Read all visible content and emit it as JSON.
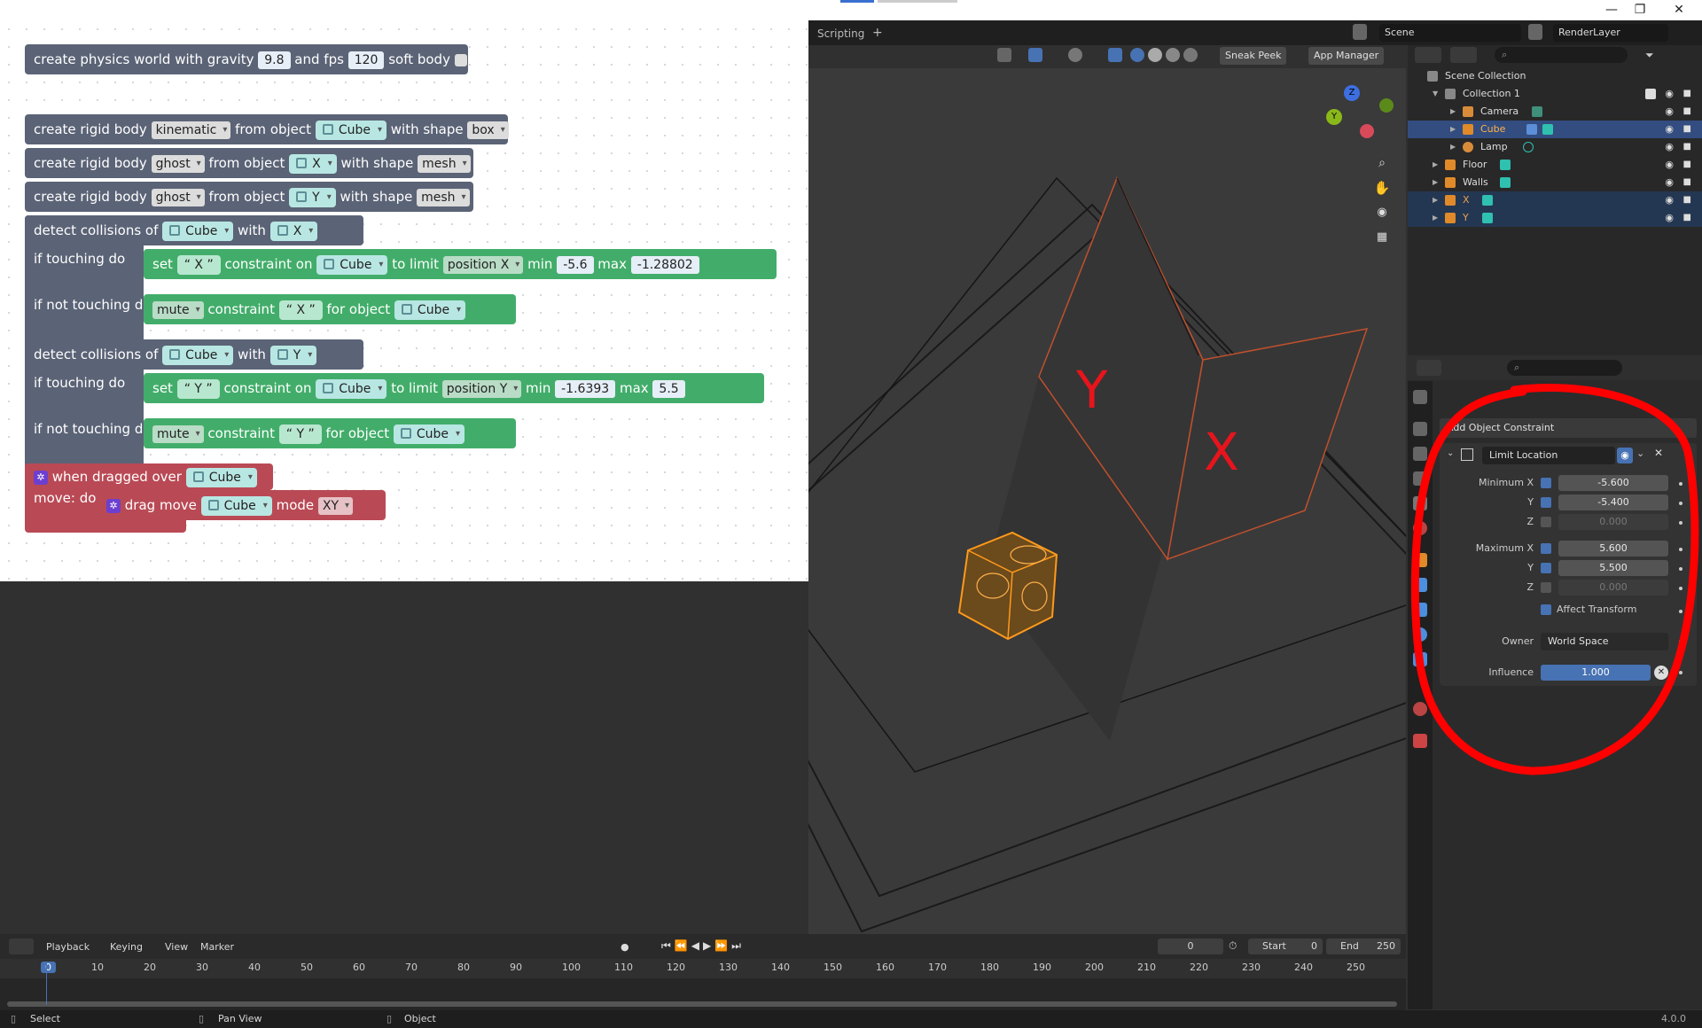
{
  "window": {
    "minimize": "—",
    "restore": "❐",
    "close": "✕"
  },
  "header": {
    "workspace_tab": "Scripting",
    "add_tab": "+",
    "scene_label": "Scene",
    "view_layer_label": "RenderLayer"
  },
  "viewport": {
    "sneak_peek": "Sneak Peek",
    "app_manager": "App Manager",
    "label_y": "Y",
    "label_x": "X"
  },
  "blocks": {
    "physics": {
      "create": "create physics world",
      "with_gravity": "with gravity",
      "gravity": "9.8",
      "and_fps": "and fps",
      "fps": "120",
      "soft_body": "soft body"
    },
    "rb1": {
      "create": "create rigid body",
      "type": "kinematic",
      "from_object": "from object",
      "object": "Cube",
      "with_shape": "with shape",
      "shape": "box"
    },
    "rb2": {
      "create": "create rigid body",
      "type": "ghost",
      "from_object": "from object",
      "object": "X",
      "with_shape": "with shape",
      "shape": "mesh"
    },
    "rb3": {
      "create": "create rigid body",
      "type": "ghost",
      "from_object": "from object",
      "object": "Y",
      "with_shape": "with shape",
      "shape": "mesh"
    },
    "det1": {
      "detect": "detect collisions of",
      "a": "Cube",
      "with": "with",
      "b": "X",
      "touching": "if touching do",
      "not_touching": "if not touching do"
    },
    "set1": {
      "set": "set",
      "name": "X",
      "constraint_on": "constraint on",
      "object": "Cube",
      "to_limit": "to limit",
      "limit": "position X",
      "min": "min",
      "min_val": "-5.6",
      "max": "max",
      "max_val": "-1.28802"
    },
    "mute1": {
      "mute": "mute",
      "constraint": "constraint",
      "name": "X",
      "for_object": "for object",
      "object": "Cube"
    },
    "det2": {
      "detect": "detect collisions of",
      "a": "Cube",
      "with": "with",
      "b": "Y",
      "touching": "if touching do",
      "not_touching": "if not touching do"
    },
    "set2": {
      "set": "set",
      "name": "Y",
      "constraint_on": "constraint on",
      "object": "Cube",
      "to_limit": "to limit",
      "limit": "position Y",
      "min": "min",
      "min_val": "-1.6393",
      "max": "max",
      "max_val": "5.5"
    },
    "mute2": {
      "mute": "mute",
      "constraint": "constraint",
      "name": "Y",
      "for_object": "for object",
      "object": "Cube"
    },
    "drag": {
      "when": "when dragged over",
      "object": "Cube",
      "move": "move: do",
      "drag_move": "drag move",
      "drag_obj": "Cube",
      "mode": "mode",
      "mode_val": "XY"
    }
  },
  "outliner": {
    "scene_collection": "Scene Collection",
    "rows": [
      {
        "label": "Collection 1"
      },
      {
        "label": "Camera"
      },
      {
        "label": "Cube"
      },
      {
        "label": "Lamp"
      },
      {
        "label": "Floor"
      },
      {
        "label": "Walls"
      },
      {
        "label": "X"
      },
      {
        "label": "Y"
      }
    ]
  },
  "properties": {
    "add_constraint": "Add Object Constraint",
    "constraint_name": "Limit Location",
    "min_x_label": "Minimum X",
    "min_x": "-5.600",
    "min_y_label": "Y",
    "min_y": "-5.400",
    "min_z_label": "Z",
    "min_z": "0.000",
    "max_x_label": "Maximum X",
    "max_x": "5.600",
    "max_y_label": "Y",
    "max_y": "5.500",
    "max_z_label": "Z",
    "max_z": "0.000",
    "affect_transform": "Affect Transform",
    "owner_label": "Owner",
    "owner": "World Space",
    "influence_label": "Influence",
    "influence": "1.000"
  },
  "timeline": {
    "playback": "Playback",
    "keying": "Keying",
    "view": "View",
    "marker": "Marker",
    "current_frame": "0",
    "start_label": "Start",
    "start": "0",
    "end_label": "End",
    "end": "250",
    "ticks": [
      "0",
      "10",
      "20",
      "30",
      "40",
      "50",
      "60",
      "70",
      "80",
      "90",
      "100",
      "110",
      "120",
      "130",
      "140",
      "150",
      "160",
      "170",
      "180",
      "190",
      "200",
      "210",
      "220",
      "230",
      "240",
      "250"
    ]
  },
  "status": {
    "select": "Select",
    "pan_view": "Pan View",
    "object": "Object",
    "version": "4.0.0"
  }
}
